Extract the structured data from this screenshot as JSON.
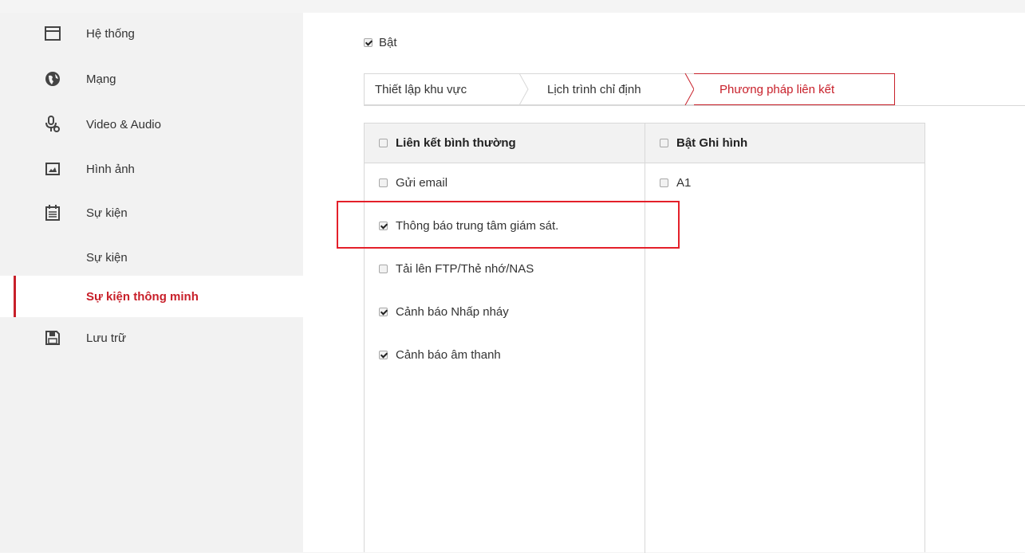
{
  "sidebar": {
    "items": [
      {
        "label": "Hệ thống",
        "icon": "system-window-icon"
      },
      {
        "label": "Mạng",
        "icon": "globe-icon"
      },
      {
        "label": "Video & Audio",
        "icon": "microphone-icon"
      },
      {
        "label": "Hình ảnh",
        "icon": "image-icon"
      },
      {
        "label": "Sự kiện",
        "icon": "calendar-icon"
      },
      {
        "label": "Sự kiện",
        "sub": true
      },
      {
        "label": "Sự kiện thông minh",
        "sub": true,
        "active": true
      },
      {
        "label": "Lưu trữ",
        "icon": "storage-icon"
      }
    ]
  },
  "enable": {
    "label": "Bật",
    "checked": true
  },
  "tabs": [
    {
      "label": "Thiết lập khu vực",
      "active": false
    },
    {
      "label": "Lịch trình chỉ định",
      "active": false
    },
    {
      "label": "Phương pháp liên kết",
      "active": true
    }
  ],
  "linkage": {
    "normal": {
      "header": "Liên kết bình thường",
      "items": [
        {
          "label": "Gửi email",
          "checked": false
        },
        {
          "label": "Thông báo trung tâm giám sát.",
          "checked": true
        },
        {
          "label": "Tải lên FTP/Thẻ nhớ/NAS",
          "checked": false
        },
        {
          "label": "Cảnh báo Nhấp nháy",
          "checked": true
        },
        {
          "label": "Cảnh báo âm thanh",
          "checked": true
        }
      ]
    },
    "record": {
      "header": "Bật Ghi hình",
      "items": [
        {
          "label": "A1",
          "checked": false
        }
      ]
    }
  },
  "colors": {
    "accent": "#c8202a",
    "highlight_box": "#e4202a"
  }
}
